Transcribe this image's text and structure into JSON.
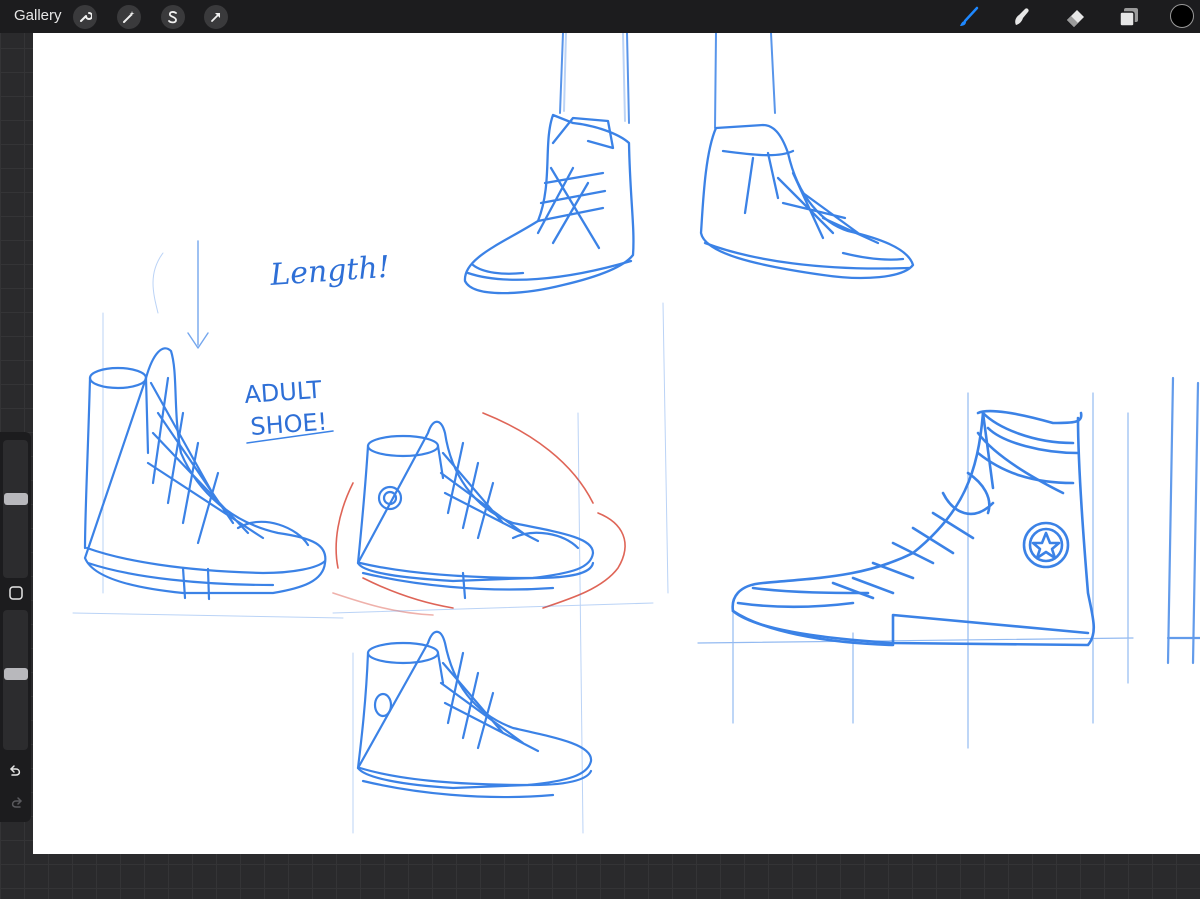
{
  "app": {
    "gallery_label": "Gallery"
  },
  "toolbar_left": [
    {
      "name": "actions",
      "icon": "wrench-icon"
    },
    {
      "name": "adjustments",
      "icon": "magic-wand-icon"
    },
    {
      "name": "selection",
      "icon": "selection-s-icon"
    },
    {
      "name": "transform",
      "icon": "arrow-cursor-icon"
    }
  ],
  "toolbar_right": [
    {
      "name": "brush",
      "icon": "brush-icon",
      "active": true,
      "color": "#1e88ff"
    },
    {
      "name": "smudge",
      "icon": "smudge-icon",
      "active": false
    },
    {
      "name": "eraser",
      "icon": "eraser-icon",
      "active": false
    },
    {
      "name": "layers",
      "icon": "layers-icon",
      "active": false
    }
  ],
  "current_color": "#000000",
  "canvas": {
    "notes": [
      "Length!",
      "ADULT",
      "SHOE!"
    ]
  },
  "sidebar": {
    "brush_size_level": 0.58,
    "opacity_level": 0.55,
    "buttons": [
      "modify-square-icon",
      "undo-icon",
      "redo-icon"
    ]
  },
  "colors": {
    "sketch_blue": "#3b82e6",
    "accent_red": "#d94a3a",
    "ui_dark": "#1c1c1e"
  }
}
